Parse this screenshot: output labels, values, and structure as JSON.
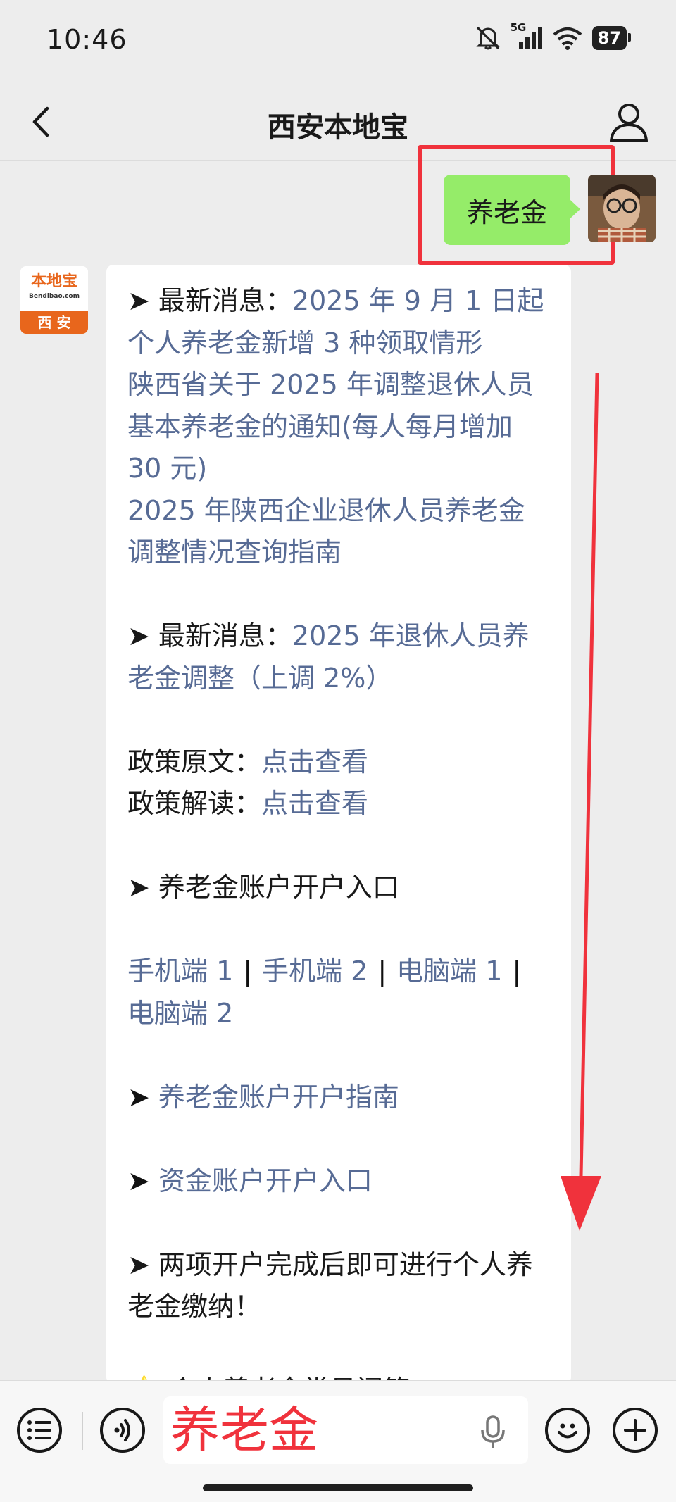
{
  "status_bar": {
    "time": "10:46",
    "network": "5G",
    "battery": "87"
  },
  "nav": {
    "title": "西安本地宝"
  },
  "sent_message": {
    "text": "养老金"
  },
  "bot": {
    "logo_top": "本地宝",
    "logo_sub": "Bendibao.com",
    "logo_city": "西 安"
  },
  "reply": {
    "s1_label": "➤ 最新消息：",
    "s1_link_a": "2025 年 9 月 1 日起",
    "s1_link_b": "个人养老金新增 3 种领取情形",
    "s1_link_c": "陕西省关于 2025 年调整退休人员",
    "s1_link_d": "基本养老金的通知(每人每月增加",
    "s1_link_e": "30 元)",
    "s1_link_f": "2025 年陕西企业退休人员养老金",
    "s1_link_g": "调整情况查询指南",
    "s2_label": "➤ 最新消息：",
    "s2_link_a": "2025 年退休人员养",
    "s2_link_b": "老金调整（上调 2%）",
    "policy_text_label": "政策原文：",
    "policy_text_link": "点击查看",
    "policy_read_label": "政策解读：",
    "policy_read_link": "点击查看",
    "s3_label": "➤ 养老金账户开户入口",
    "mobile_1": "手机端 1",
    "mobile_2": "手机端 2",
    "pc_1": "电脑端 1",
    "pc_2": "电脑端 2",
    "separator": "|",
    "s4_bullet": "➤ ",
    "s4_link": "养老金账户开户指南",
    "s5_bullet": "➤ ",
    "s5_link": "资金账户开户入口",
    "s6_a": "➤ 两项开户完成后即可进行个人养",
    "s6_b": "老金缴纳！",
    "s7_partial": "⭐ 个人养老金常见问答"
  },
  "input": {
    "value": "养老金"
  },
  "colors": {
    "highlight": "#f0323c",
    "link": "#576b95",
    "sent_bubble": "#95ec69"
  },
  "icons": [
    "back-icon",
    "profile-icon",
    "menu-list-icon",
    "voice-icon",
    "mic-icon",
    "emoji-icon",
    "plus-icon"
  ]
}
